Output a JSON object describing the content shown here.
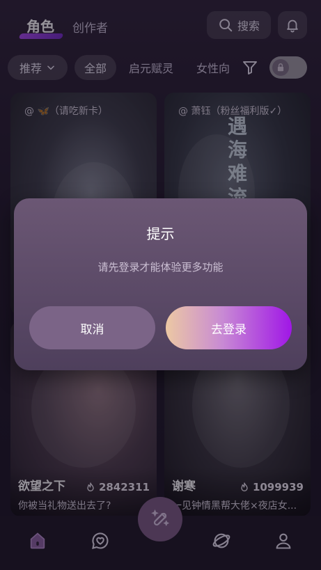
{
  "header": {
    "tab_active": "角色",
    "tab_other": "创作者",
    "search_label": "搜索"
  },
  "filters": {
    "sort_label": "推荐",
    "all_label": "全部",
    "category_1": "启元赋灵",
    "category_2": "女性向"
  },
  "cards": [
    {
      "tag": "@ 🦋（请吃新卡）"
    },
    {
      "tag": "@ 萧钰（粉丝福利版✓）",
      "poster_text": "遇海难流"
    },
    {
      "name": "欲望之下",
      "count": "2842311",
      "desc": "你被当礼物送出去了?"
    },
    {
      "name": "谢寒",
      "count": "1099939",
      "desc": "一见钟情黑帮大佬×夜店女..."
    }
  ],
  "dialog": {
    "title": "提示",
    "message": "请先登录才能体验更多功能",
    "cancel_label": "取消",
    "confirm_label": "去登录"
  },
  "colors": {
    "accent": "#a017e6",
    "dialog_bg": "#5e4b69",
    "cancel_bg": "#7b6487"
  },
  "icons": {
    "search": "search-icon",
    "bell": "bell-icon",
    "filter": "filter-icon",
    "lock": "lock-icon",
    "home": "home-icon",
    "chat": "heart-chat-icon",
    "create": "magic-wand-icon",
    "explore": "planet-icon",
    "profile": "user-icon"
  }
}
